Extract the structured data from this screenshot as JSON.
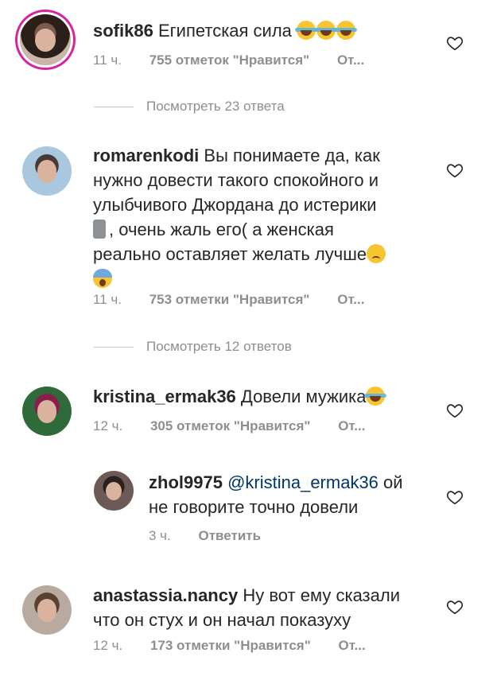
{
  "comments": [
    {
      "username": "sofik86",
      "text": "Египетская сила",
      "time": "11 ч.",
      "likes": "755 отметок \"Нравится\"",
      "reply": "От...",
      "view_replies": "Посмотреть 23 ответа"
    },
    {
      "username": "romarenkodi",
      "text_line1": "Вы понимаете да, как",
      "text_line2": "нужно довести такого спокойного и",
      "text_line3": "улыбчивого Джордана до истерики",
      "text_line4": ", очень жаль его( а женская",
      "text_line5": "реально оставляет желать лучше",
      "time": "11 ч.",
      "likes": "753 отметки \"Нравится\"",
      "reply": "От...",
      "view_replies": "Посмотреть 12 ответов"
    },
    {
      "username": "kristina_ermak36",
      "text": "Довели мужика",
      "time": "12 ч.",
      "likes": "305 отметок \"Нравится\"",
      "reply": "От..."
    },
    {
      "username": "zhol9975",
      "mention": "@kristina_ermak36",
      "text_line1": "ой",
      "text_line2": "не говорите  точно довели",
      "time": "3 ч.",
      "reply": "Ответить"
    },
    {
      "username": "anastassia.nancy",
      "text_line1": "Ну вот ему сказали",
      "text_line2": "что он стух и он начал показуху",
      "time": "12 ч.",
      "likes": "173 отметки \"Нравится\"",
      "reply": "От..."
    }
  ],
  "icons": {
    "like": "heart-outline-icon",
    "emoji_laugh": "face-with-tears-of-joy",
    "emoji_moai": "moai",
    "emoji_sad": "frowning-face",
    "emoji_scream": "face-screaming-in-fear"
  },
  "colors": {
    "text": "#262626",
    "meta": "#8e8e8e",
    "mention": "#003569",
    "story_ring": "#d6249f"
  }
}
